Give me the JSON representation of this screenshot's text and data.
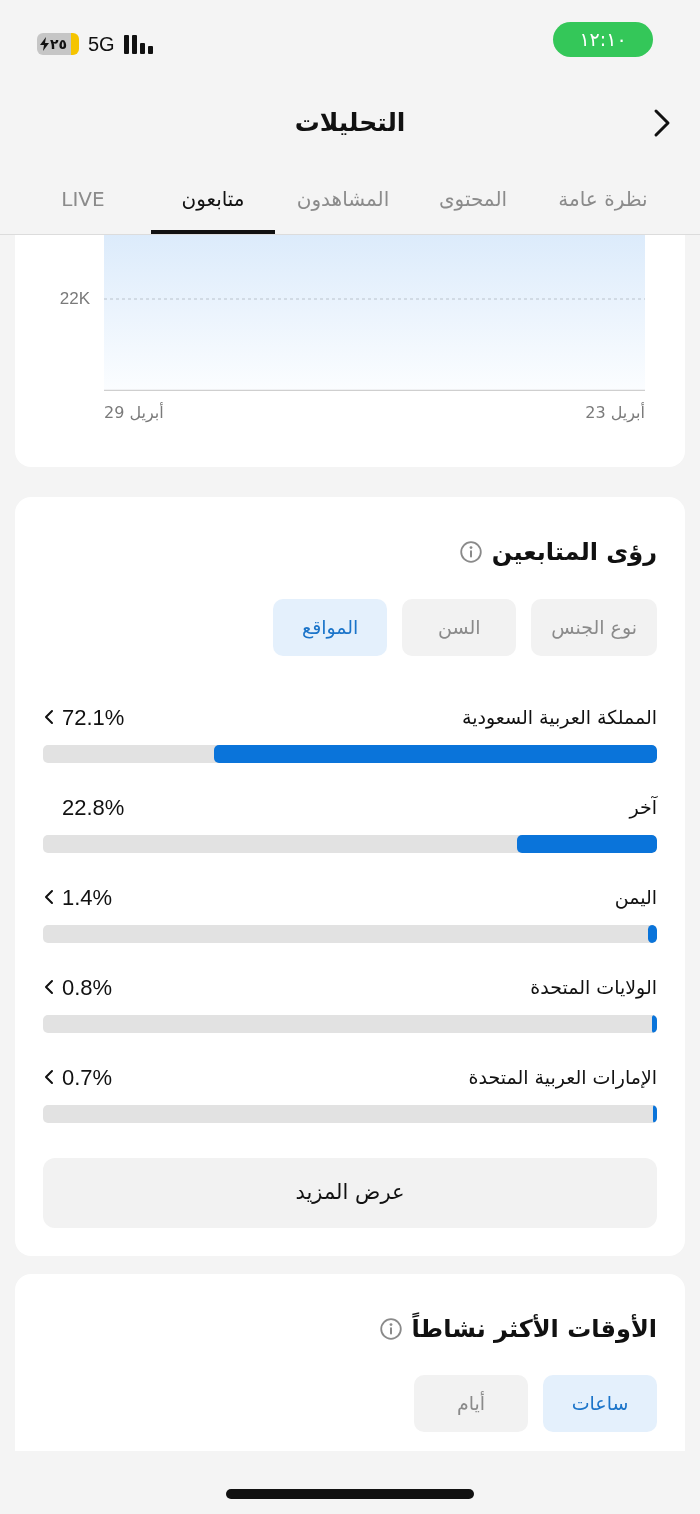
{
  "status_bar": {
    "time": "١٢:١٠",
    "battery_text": "٢٥",
    "network": "5G"
  },
  "header": {
    "title": "التحليلات"
  },
  "tabs": [
    {
      "label": "نظرة عامة",
      "selected": false
    },
    {
      "label": "المحتوى",
      "selected": false
    },
    {
      "label": "المشاهدون",
      "selected": false
    },
    {
      "label": "متابعون",
      "selected": true
    },
    {
      "label": "LIVE",
      "selected": false
    }
  ],
  "follower_chart": {
    "y_tick": "22K",
    "x_labels": [
      "أبريل 23",
      "أبريل 29"
    ]
  },
  "follower_insights": {
    "title": "رؤى المتابعين",
    "filters": [
      {
        "label": "نوع الجنس",
        "selected": false
      },
      {
        "label": "السن",
        "selected": false
      },
      {
        "label": "المواقع",
        "selected": true
      }
    ],
    "locations": [
      {
        "name": "المملكة العربية السعودية",
        "percent": "72.1%",
        "level": 0.721,
        "expandable": true
      },
      {
        "name": "آخر",
        "percent": "22.8%",
        "level": 0.228,
        "expandable": false
      },
      {
        "name": "اليمن",
        "percent": "1.4%",
        "level": 0.014,
        "expandable": true
      },
      {
        "name": "الولايات المتحدة",
        "percent": "0.8%",
        "level": 0.008,
        "expandable": true
      },
      {
        "name": "الإمارات العربية المتحدة",
        "percent": "0.7%",
        "level": 0.007,
        "expandable": true
      }
    ],
    "more_button": "عرض المزيد"
  },
  "active_times": {
    "title": "الأوقات الأكثر نشاطاً",
    "filters": [
      {
        "label": "ساعات",
        "selected": true
      },
      {
        "label": "أيام",
        "selected": false
      }
    ]
  }
}
